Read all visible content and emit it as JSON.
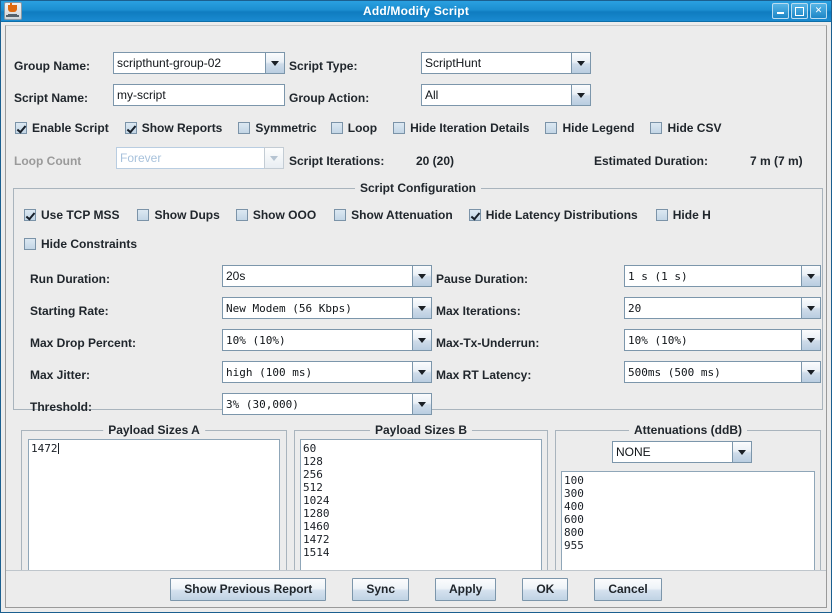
{
  "window": {
    "title": "Add/Modify Script",
    "icon": "java-cup-icon",
    "minimize_label": "–",
    "maximize_label": "□",
    "close_label": "✕"
  },
  "header": {
    "group_name_label": "Group Name:",
    "group_name_value": "scripthunt-group-02",
    "script_type_label": "Script Type:",
    "script_type_value": "ScriptHunt",
    "script_name_label": "Script Name:",
    "script_name_value": "my-script",
    "group_action_label": "Group Action:",
    "group_action_value": "All"
  },
  "top_checkboxes": [
    {
      "label": "Enable Script",
      "checked": true
    },
    {
      "label": "Show Reports",
      "checked": true
    },
    {
      "label": "Symmetric",
      "checked": false
    },
    {
      "label": "Loop",
      "checked": false
    },
    {
      "label": "Hide Iteration Details",
      "checked": false
    },
    {
      "label": "Hide Legend",
      "checked": false
    },
    {
      "label": "Hide CSV",
      "checked": false
    }
  ],
  "loop_row": {
    "loop_count_label": "Loop Count",
    "loop_count_value": "Forever",
    "loop_count_disabled": true,
    "script_iterations_label": "Script Iterations:",
    "script_iterations_value": "20 (20)",
    "estimated_duration_label": "Estimated Duration:",
    "estimated_duration_value": "7 m (7 m)"
  },
  "script_configuration": {
    "title": "Script Configuration",
    "checkboxes_row1": [
      {
        "label": "Use TCP MSS",
        "checked": true
      },
      {
        "label": "Show Dups",
        "checked": false
      },
      {
        "label": "Show OOO",
        "checked": false
      },
      {
        "label": "Show Attenuation",
        "checked": false
      },
      {
        "label": "Hide Latency Distributions",
        "checked": true
      },
      {
        "label": "Hide H",
        "checked": false
      }
    ],
    "checkboxes_row2": [
      {
        "label": "Hide Constraints",
        "checked": false
      }
    ],
    "fields_left": [
      {
        "label": "Run Duration:",
        "value": "20s",
        "mono": false
      },
      {
        "label": "Starting Rate:",
        "value": "New Modem (56 Kbps)",
        "mono": true
      },
      {
        "label": "Max Drop Percent:",
        "value": "10% (10%)",
        "mono": true
      },
      {
        "label": "Max Jitter:",
        "value": "high (100 ms)",
        "mono": true
      },
      {
        "label": "Threshold:",
        "value": " 3%   (30,000)",
        "mono": true
      }
    ],
    "fields_right": [
      {
        "label": "Pause Duration:",
        "value": " 1 s    (1 s)",
        "mono": true
      },
      {
        "label": "Max Iterations:",
        "value": "20",
        "mono": true
      },
      {
        "label": "Max-Tx-Underrun:",
        "value": "10% (10%)",
        "mono": true
      },
      {
        "label": "Max RT Latency:",
        "value": "500ms (500 ms)",
        "mono": true
      }
    ]
  },
  "payload_a": {
    "title": "Payload Sizes A",
    "lines": [
      "1472"
    ]
  },
  "payload_b": {
    "title": "Payload Sizes B",
    "lines": [
      "60",
      "128",
      "256",
      "512",
      "1024",
      "1280",
      "1460",
      "1472",
      "1514"
    ]
  },
  "attenuations": {
    "title": "Attenuations (ddB)",
    "selected": "NONE",
    "lines": [
      "100",
      "300",
      "400",
      "600",
      "800",
      "955"
    ]
  },
  "buttons": [
    {
      "label": "Show Previous Report"
    },
    {
      "label": "Sync"
    },
    {
      "label": "Apply"
    },
    {
      "label": "OK"
    },
    {
      "label": "Cancel"
    }
  ],
  "colors": {
    "titlebar": "#1b8ed0",
    "panel_bg": "#ececec",
    "field_border": "#7c96ab",
    "text": "#20262c"
  }
}
